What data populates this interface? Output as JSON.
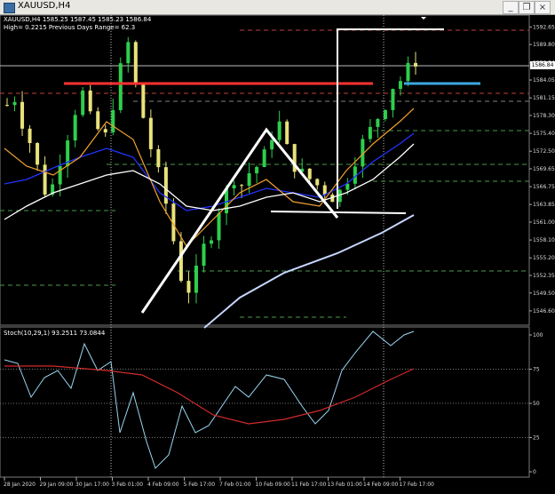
{
  "window": {
    "title": "XAUUSD,H4",
    "minimize_label": "_",
    "restore_label": "❐",
    "close_label": "×"
  },
  "info_lines": {
    "quote": "XAUUSD,H4  1585.25 1587.45 1585.23 1586.84",
    "stats": "High= 0.2215   Previous Days Range= 62.3"
  },
  "current_price": "1586.84",
  "stoch_label": "Stoch(10,29,1) 93.2511 73.0844",
  "colors": {
    "background": "#000000",
    "bull": "#2ecf4c",
    "bear": "#e8e27a",
    "red_line": "#ff3131",
    "blue_line": "#3da7e0",
    "ma_blue": "#2233ff",
    "ma_orange": "#f0a030",
    "ma_white": "#ffffff",
    "ma_lightblue": "#c6d6ff",
    "stoch_main": "#9ad7f0",
    "stoch_signal": "#d22b2b"
  },
  "chart_data": [
    {
      "type": "candlestick",
      "price_axis": {
        "ylim": [
          1545.0,
          1594.0
        ],
        "ticks": [
          "1592.65",
          "1589.80",
          "1586.84",
          "1584.05",
          "1581.15",
          "1578.30",
          "1575.40",
          "1572.50",
          "1569.65",
          "1566.75",
          "1563.85",
          "1561.00",
          "1558.10",
          "1555.20",
          "1552.35",
          "1549.50",
          "1546.60"
        ]
      },
      "time_axis": {
        "ticks": [
          "28 Jan 2020",
          "29 Jan 09:00",
          "30 Jan 17:00",
          "3 Feb 01:00",
          "4 Feb 09:00",
          "5 Feb 17:00",
          "7 Feb 01:00",
          "10 Feb 09:00",
          "11 Feb 17:00",
          "13 Feb 01:00",
          "14 Feb 09:00",
          "17 Feb 17:00"
        ]
      },
      "horizontal_levels": {
        "red_support": 1584.2,
        "blue_target": 1584.1
      }
    },
    {
      "type": "line",
      "title": "Stoch(10,29,1) 93.2511 73.0844",
      "ylim": [
        0,
        100
      ],
      "ticks": [
        "100",
        "75",
        "50",
        "25",
        "0"
      ]
    }
  ]
}
